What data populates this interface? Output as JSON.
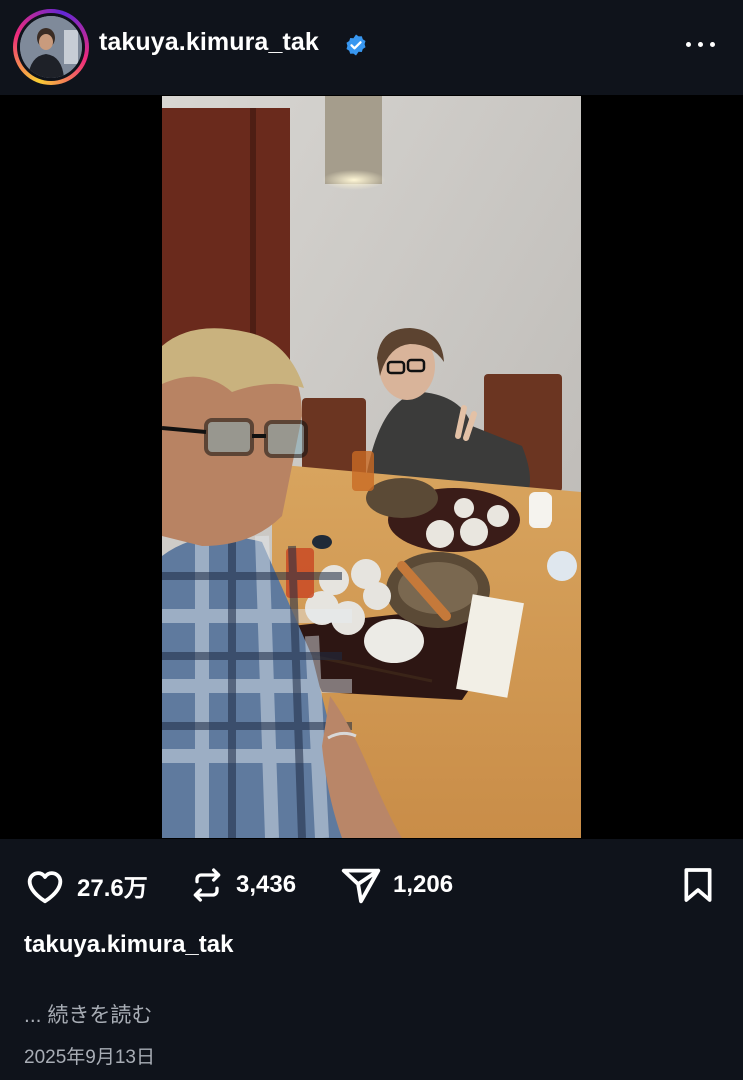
{
  "post": {
    "username": "takuya.kimura_tak",
    "verified_icon": "verified-badge-icon",
    "menu_icon": "more-horizontal-icon",
    "photo_alt": "Two men seated at a wooden table with lunch trays",
    "likes": "27.6万",
    "reposts": "3,436",
    "shares": "1,206",
    "caption_user": "takuya.kimura_tak",
    "read_more": "... 続きを読む",
    "date": "2025年9月13日"
  },
  "icons": {
    "like": "heart-icon",
    "repost": "repost-icon",
    "share": "send-icon",
    "save": "bookmark-icon"
  },
  "colors": {
    "background": "#0f131b",
    "text": "#ffffff",
    "muted": "#a8adb5",
    "verified": "#3897f0"
  }
}
